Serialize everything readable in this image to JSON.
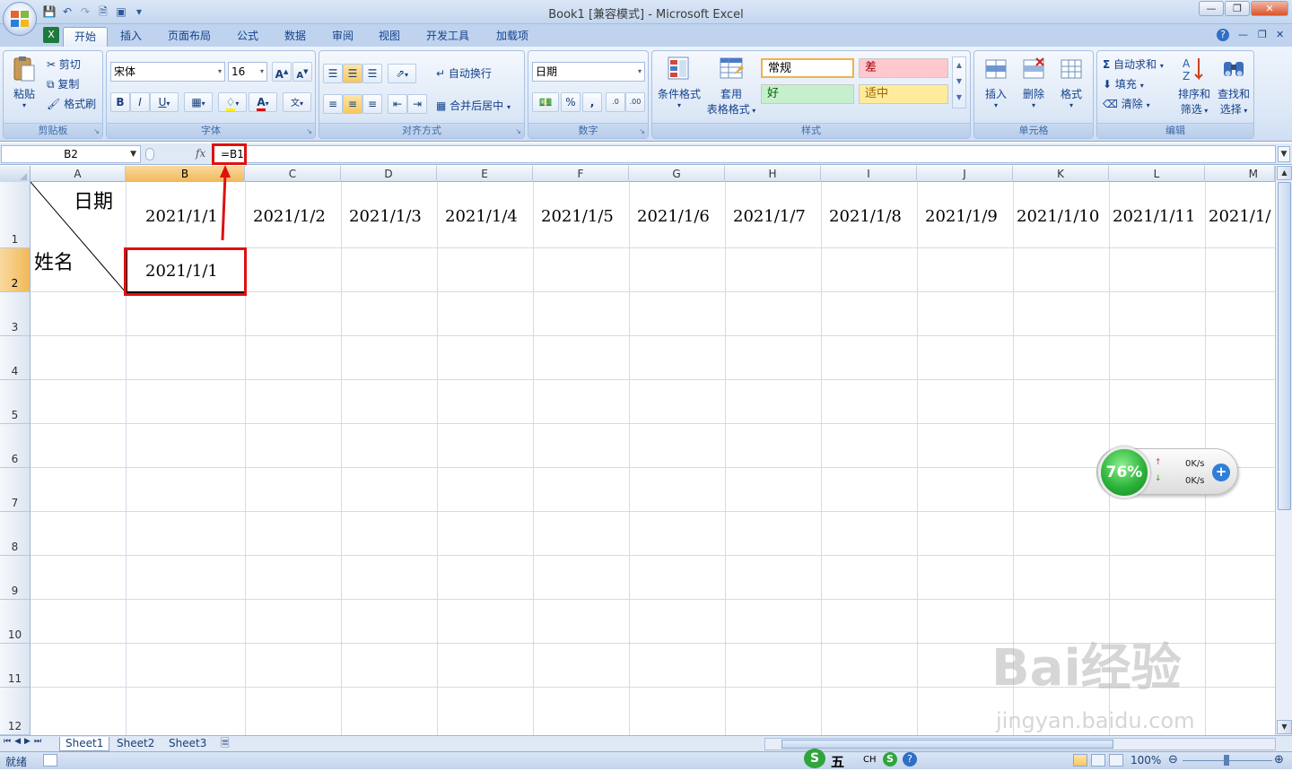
{
  "window": {
    "title": "Book1  [兼容模式] - Microsoft Excel"
  },
  "tabs": [
    "开始",
    "插入",
    "页面布局",
    "公式",
    "数据",
    "审阅",
    "视图",
    "开发工具",
    "加载项"
  ],
  "active_tab": "开始",
  "ribbon": {
    "clipboard": {
      "label": "剪贴板",
      "paste": "粘贴",
      "cut": "剪切",
      "copy": "复制",
      "format_painter": "格式刷"
    },
    "font": {
      "label": "字体",
      "font_name": "宋体",
      "font_size": "16",
      "bold": "B",
      "italic": "I",
      "underline": "U",
      "grow": "A",
      "shrink": "A"
    },
    "alignment": {
      "label": "对齐方式",
      "wrap": "自动换行",
      "merge": "合并后居中"
    },
    "number": {
      "label": "数字",
      "format": "日期",
      "percent": "%",
      "comma": ",",
      "inc": ".0",
      "dec": ".00"
    },
    "styles": {
      "label": "样式",
      "conditional": "条件格式",
      "table_format_1": "套用",
      "table_format_2": "表格格式",
      "normal": "常规",
      "bad": "差",
      "good": "好",
      "neutral": "适中"
    },
    "cells": {
      "label": "单元格",
      "insert": "插入",
      "delete": "删除",
      "format": "格式"
    },
    "editing": {
      "label": "编辑",
      "autosum": "自动求和",
      "fill": "填充",
      "clear": "清除",
      "sort_1": "排序和",
      "sort_2": "筛选",
      "find_1": "查找和",
      "find_2": "选择"
    }
  },
  "formula_bar": {
    "name_box": "B2",
    "fx": "fx",
    "formula": "=B1"
  },
  "columns": [
    "A",
    "B",
    "C",
    "D",
    "E",
    "F",
    "G",
    "H",
    "I",
    "J",
    "K",
    "L",
    "M"
  ],
  "rows": [
    "1",
    "2",
    "3",
    "4",
    "5",
    "6",
    "7",
    "8",
    "9",
    "10",
    "11",
    "12"
  ],
  "cells": {
    "A1_top": "日期",
    "A1_bottom": "姓名",
    "B1": "2021/1/1",
    "C1": "2021/1/2",
    "D1": "2021/1/3",
    "E1": "2021/1/4",
    "F1": "2021/1/5",
    "G1": "2021/1/6",
    "H1": "2021/1/7",
    "I1": "2021/1/8",
    "J1": "2021/1/9",
    "K1": "2021/1/10",
    "L1": "2021/1/11",
    "M1": "2021/1/",
    "B2": "2021/1/1"
  },
  "sheets": [
    "Sheet1",
    "Sheet2",
    "Sheet3"
  ],
  "status": {
    "ready": "就绪",
    "zoom": "100%",
    "ime": "五",
    "ime_lang": "CH"
  },
  "widget": {
    "percent": "76%",
    "up": "0K/s",
    "down": "0K/s"
  },
  "watermark": {
    "text": "Bai经验",
    "url": "jingyan.baidu.com"
  },
  "colors": {
    "accent": "#15428b",
    "annotation": "#e01010",
    "selected_header": "#f1b958"
  }
}
